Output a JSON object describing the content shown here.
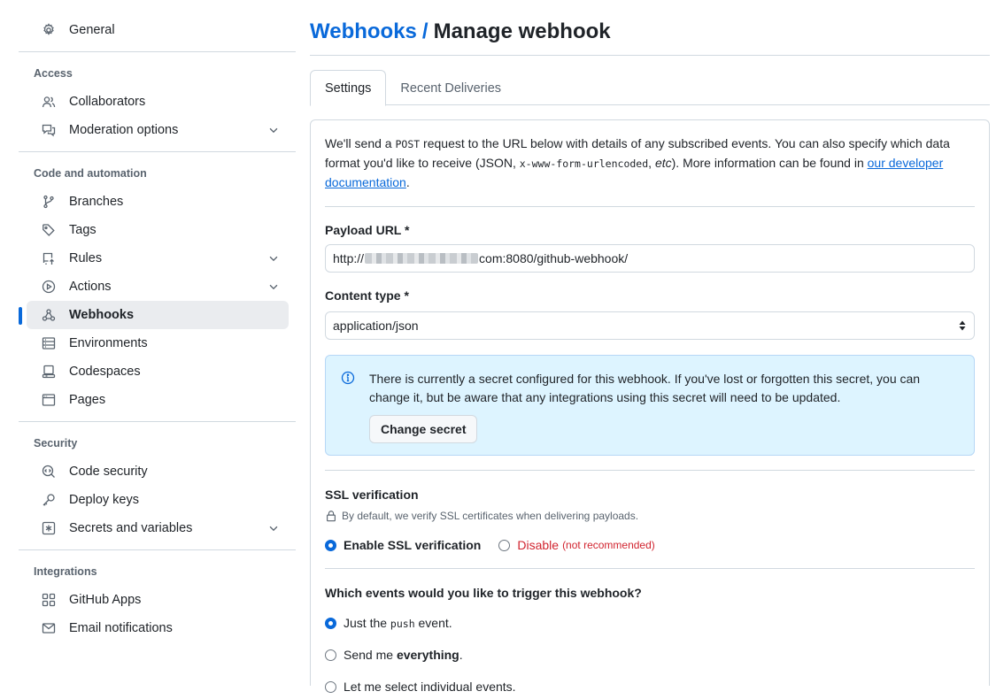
{
  "sidebar": {
    "general": "General",
    "sections": {
      "access": "Access",
      "code_automation": "Code and automation",
      "security": "Security",
      "integrations": "Integrations"
    },
    "items": {
      "collaborators": "Collaborators",
      "moderation": "Moderation options",
      "branches": "Branches",
      "tags": "Tags",
      "rules": "Rules",
      "actions": "Actions",
      "webhooks": "Webhooks",
      "environments": "Environments",
      "codespaces": "Codespaces",
      "pages": "Pages",
      "code_security": "Code security",
      "deploy_keys": "Deploy keys",
      "secrets": "Secrets and variables",
      "github_apps": "GitHub Apps",
      "email": "Email notifications"
    },
    "active_item": "Webhooks",
    "accent_color": "#0969da"
  },
  "header": {
    "breadcrumb_link": "Webhooks",
    "separator": "/",
    "title": "Manage webhook"
  },
  "tabs": {
    "settings": "Settings",
    "recent": "Recent Deliveries",
    "selected": "Settings"
  },
  "intro": {
    "part1": "We'll send a ",
    "post": "POST",
    "part2": " request to the URL below with details of any subscribed events. You can also specify which data format you'd like to receive (JSON, ",
    "form": "x-www-form-urlencoded",
    "part3": ", ",
    "etc": "etc",
    "part4": "). More information can be found in ",
    "link": "our developer documentation",
    "part5": "."
  },
  "payload_url": {
    "label": "Payload URL *",
    "prefix": "http://",
    "suffix": "com:8080/github-webhook/"
  },
  "content_type": {
    "label": "Content type *",
    "value": "application/json"
  },
  "secret_flash": {
    "text": "There is currently a secret configured for this webhook. If you've lost or forgotten this secret, you can change it, but be aware that any integrations using this secret will need to be updated.",
    "button": "Change secret"
  },
  "ssl": {
    "title": "SSL verification",
    "note": "By default, we verify SSL certificates when delivering payloads.",
    "enable": "Enable SSL verification",
    "disable": "Disable",
    "disable_note": "(not recommended)",
    "selected": "enable"
  },
  "events": {
    "title": "Which events would you like to trigger this webhook?",
    "opt1_pre": "Just the ",
    "opt1_code": "push",
    "opt1_post": " event.",
    "opt2_pre": "Send me ",
    "opt2_bold": "everything",
    "opt2_post": ".",
    "opt3": "Let me select individual events.",
    "selected": "push"
  }
}
